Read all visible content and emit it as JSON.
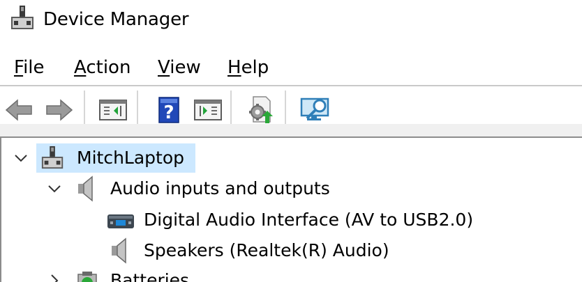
{
  "window": {
    "title": "Device Manager",
    "icon": "device-manager-icon"
  },
  "menu": {
    "items": [
      {
        "label": "File",
        "mnemonic": "F",
        "rest": "ile"
      },
      {
        "label": "Action",
        "mnemonic": "A",
        "rest": "ction"
      },
      {
        "label": "View",
        "mnemonic": "V",
        "rest": "iew"
      },
      {
        "label": "Help",
        "mnemonic": "H",
        "rest": "elp"
      }
    ]
  },
  "toolbar": {
    "buttons": [
      {
        "name": "back-button",
        "icon": "arrow-left-icon"
      },
      {
        "name": "forward-button",
        "icon": "arrow-right-icon"
      },
      {
        "name": "show-hide-console-tree-button",
        "icon": "console-tree-icon"
      },
      {
        "name": "help-button",
        "icon": "help-icon"
      },
      {
        "name": "show-hide-action-pane-button",
        "icon": "action-pane-icon"
      },
      {
        "name": "update-driver-button",
        "icon": "update-driver-icon"
      },
      {
        "name": "scan-hardware-button",
        "icon": "scan-monitor-icon"
      }
    ]
  },
  "tree": {
    "root": {
      "label": "MitchLaptop",
      "expanded": true,
      "selected": true,
      "icon": "computer-icon"
    },
    "categories": [
      {
        "label": "Audio inputs and outputs",
        "expanded": true,
        "icon": "speaker-icon",
        "children": [
          {
            "label": "Digital Audio Interface (AV to USB2.0)",
            "icon": "audio-interface-icon"
          },
          {
            "label": "Speakers (Realtek(R) Audio)",
            "icon": "speaker-icon"
          }
        ]
      },
      {
        "label": "Batteries",
        "expanded": false,
        "icon": "battery-icon",
        "children": []
      }
    ]
  },
  "colors": {
    "selection": "#cce8ff",
    "accent_blue": "#1e5bc6",
    "border": "#8c8c8c"
  }
}
